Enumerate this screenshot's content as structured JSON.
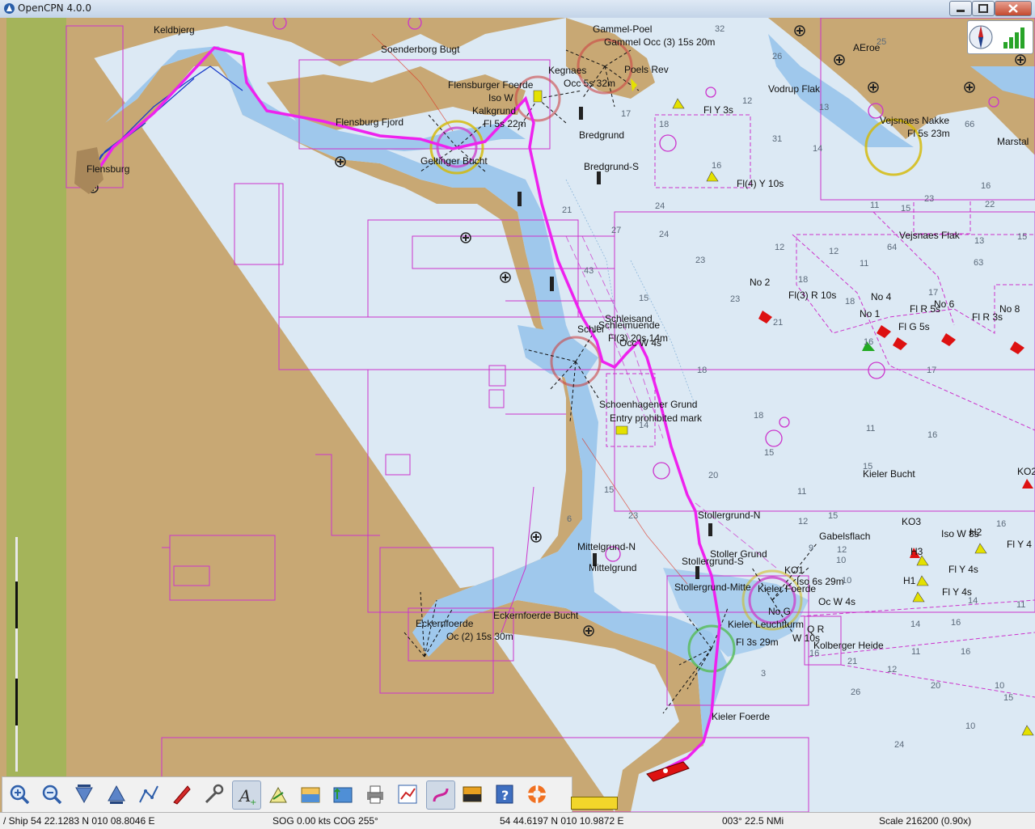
{
  "window": {
    "title": "OpenCPN 4.0.0"
  },
  "chart_labels": {
    "keldbjerg": "Keldbjerg",
    "soenderborg": "Soenderborg Bugt",
    "gammel_poel": "Gammel-Poel",
    "gammel_light": "Gammel Occ (3) 15s 20m",
    "kegnaes": "Kegnaes",
    "poels_rev": "Poels Rev",
    "flensburger_foerde": "Flensburger Foerde",
    "occ_5s": "Occ 5s 32m",
    "iso_w": "Iso W",
    "kalkgrund": "Kalkgrund",
    "fl_5s22": "Fl 5s 22m",
    "flensburg_fjord": "Flensburg Fjord",
    "bredgrund": "Bredgrund",
    "bredgrund_s": "Bredgrund-S",
    "flensburg": "Flensburg",
    "geltinger": "Geltinger Bucht",
    "fl_y3": "Fl Y 3s",
    "fl4_y10": "Fl(4) Y 10s",
    "aeroe": "AEroe",
    "vodrup": "Vodrup Flak",
    "vejsnaes_nakke": "Vejsnaes Nakke",
    "fl_5s23": "Fl 5s 23m",
    "marstal": "Marstal",
    "vejsnaes_flak": "Vejsnaes Flak",
    "no2": "No 2",
    "fl3_r10": "Fl(3) R 10s",
    "no4": "No 4",
    "no1": "No 1",
    "fl_r5": "Fl R 5s",
    "no6": "No 6",
    "fl_g5": "Fl G 5s",
    "fl_r3": "Fl R 3s",
    "no8": "No 8",
    "schleisand": "Schleisand",
    "schleimuende": "Schleimuende",
    "fl3_20s14": "Fl(3) 20s 14m",
    "occ_w4": "Occ W 4s",
    "schlei": "Schlei",
    "schoenhagener": "Schoenhagener Grund",
    "entry_prohib": "Entry prohibited mark",
    "kieler_bucht": "Kieler Bucht",
    "ko2_right": "KO2",
    "stollergrund_n": "Stollergrund-N",
    "gabelsflach": "Gabelsflach",
    "ko3": "KO3",
    "iso_w8": "Iso W 8s",
    "h2": "H2",
    "fl_y4_a": "Fl Y 4",
    "stoller_grund": "Stoller Grund",
    "stollergrund_s": "Stollergrund-S",
    "mittelgrund_n": "Mittelgrund-N",
    "mittelgrund": "Mittelgrund",
    "ko1": "KO1",
    "kieler_foerde_light": "Kieler Foerde",
    "iso_6s29": "Iso 6s 29m",
    "occ_w4b": "Oc W 4s",
    "h3": "H3",
    "fl_y4_b": "Fl Y 4s",
    "h1": "H1",
    "fl_y4_c": "Fl Y 4s",
    "eckernfoerde_bucht": "Eckernfoerde Bucht",
    "eckernfoerde": "Eckernfoerde",
    "eckern_light": "Oc (2) 15s 30m",
    "friedrichsort": "Kieler Leuchtturm",
    "fl_3s29": "Fl 3s 29m",
    "q_r": "Q R",
    "w10s": "W 10s",
    "kolberger_heide": "Kolberger Heide",
    "kieler_foerde": "Kieler Foerde",
    "stollergrund_mid": "Stollergrund-Mitte",
    "no_g": "No G"
  },
  "depths": [
    "32",
    "26",
    "17",
    "18",
    "31",
    "14",
    "16",
    "12",
    "13",
    "11",
    "16",
    "23",
    "15",
    "13",
    "24",
    "24",
    "21",
    "27",
    "23",
    "12",
    "12",
    "18",
    "15",
    "17",
    "16",
    "23",
    "21",
    "18",
    "15",
    "17",
    "18",
    "16",
    "20",
    "11",
    "11",
    "12",
    "15",
    "14",
    "16",
    "10",
    "12",
    "23",
    "15",
    "14",
    "16",
    "16",
    "10",
    "21",
    "16",
    "12",
    "11",
    "9",
    "10",
    "14",
    "11",
    "3",
    "6",
    "25",
    "22",
    "15",
    "11",
    "10",
    "15",
    "20",
    "26",
    "24",
    "66",
    "64",
    "63",
    "18",
    "43",
    "15"
  ],
  "colors": {
    "route": "#ee22ee",
    "land": "#c8a874",
    "shallow": "#9fc8ec",
    "deep": "#dce9f4",
    "boundary": "#cc33cc"
  },
  "toolbar": {
    "buttons": [
      {
        "icon": "zoom-in-icon"
      },
      {
        "icon": "zoom-out-icon"
      },
      {
        "icon": "scale-down-icon"
      },
      {
        "icon": "scale-up-icon"
      },
      {
        "icon": "route-icon"
      },
      {
        "icon": "track-icon"
      },
      {
        "icon": "settings-icon"
      },
      {
        "icon": "text-icon"
      },
      {
        "icon": "mob-icon"
      },
      {
        "icon": "tides-icon"
      },
      {
        "icon": "currents-icon"
      },
      {
        "icon": "print-icon"
      },
      {
        "icon": "route-manager-icon"
      },
      {
        "icon": "track-on-icon"
      },
      {
        "icon": "color-scheme-icon"
      },
      {
        "icon": "help-icon"
      },
      {
        "icon": "lifebuoy-icon"
      }
    ]
  },
  "status": {
    "ship": "/ Ship 54 22.1283 N   010 08.8046 E",
    "sog": "SOG 0.00 kts  COG 255°",
    "cursor": "54 44.6197 N   010 10.9872 E",
    "bearing": "003°  22.5 NMi",
    "scale": "Scale 216200 (0.90x)"
  }
}
